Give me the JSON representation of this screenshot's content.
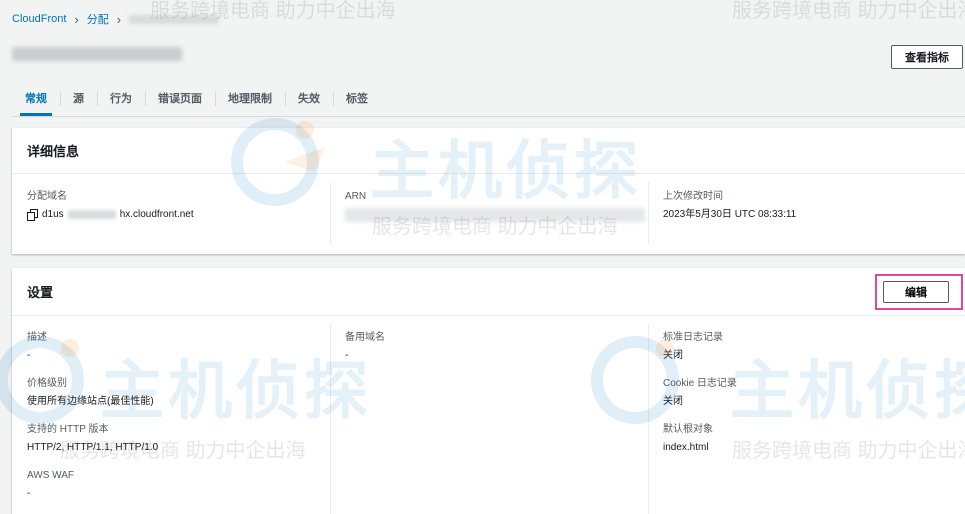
{
  "breadcrumb": {
    "root": "CloudFront",
    "section": "分配"
  },
  "header": {
    "view_metrics_label": "查看指标"
  },
  "tabs": [
    {
      "label": "常规",
      "active": true
    },
    {
      "label": "源"
    },
    {
      "label": "行为"
    },
    {
      "label": "错误页面"
    },
    {
      "label": "地理限制"
    },
    {
      "label": "失效"
    },
    {
      "label": "标签"
    }
  ],
  "details": {
    "title": "详细信息",
    "domain_label": "分配域名",
    "domain_prefix": "d1us",
    "domain_suffix": "hx.cloudfront.net",
    "arn_label": "ARN",
    "modified_label": "上次修改时间",
    "modified_value": "2023年5月30日 UTC 08:33:11"
  },
  "settings": {
    "title": "设置",
    "edit_label": "编辑",
    "description_label": "描述",
    "description_value": "-",
    "price_class_label": "价格级别",
    "price_class_value": "使用所有边缘站点(最佳性能)",
    "http_label": "支持的 HTTP 版本",
    "http_value": "HTTP/2, HTTP/1.1, HTTP/1.0",
    "waf_label": "AWS WAF",
    "waf_value": "-",
    "alt_domain_label": "备用域名",
    "alt_domain_value": "-",
    "std_log_label": "标准日志记录",
    "std_log_value": "关闭",
    "cookie_log_label": "Cookie 日志记录",
    "cookie_log_value": "关闭",
    "root_object_label": "默认根对象",
    "root_object_value": "index.html"
  },
  "watermark": {
    "brand": "主机侦探",
    "slogan": "服务跨境电商 助力中企出海"
  },
  "colors": {
    "link": "#0073bb",
    "highlight": "#e2479a",
    "background": "#f2f3f3"
  }
}
